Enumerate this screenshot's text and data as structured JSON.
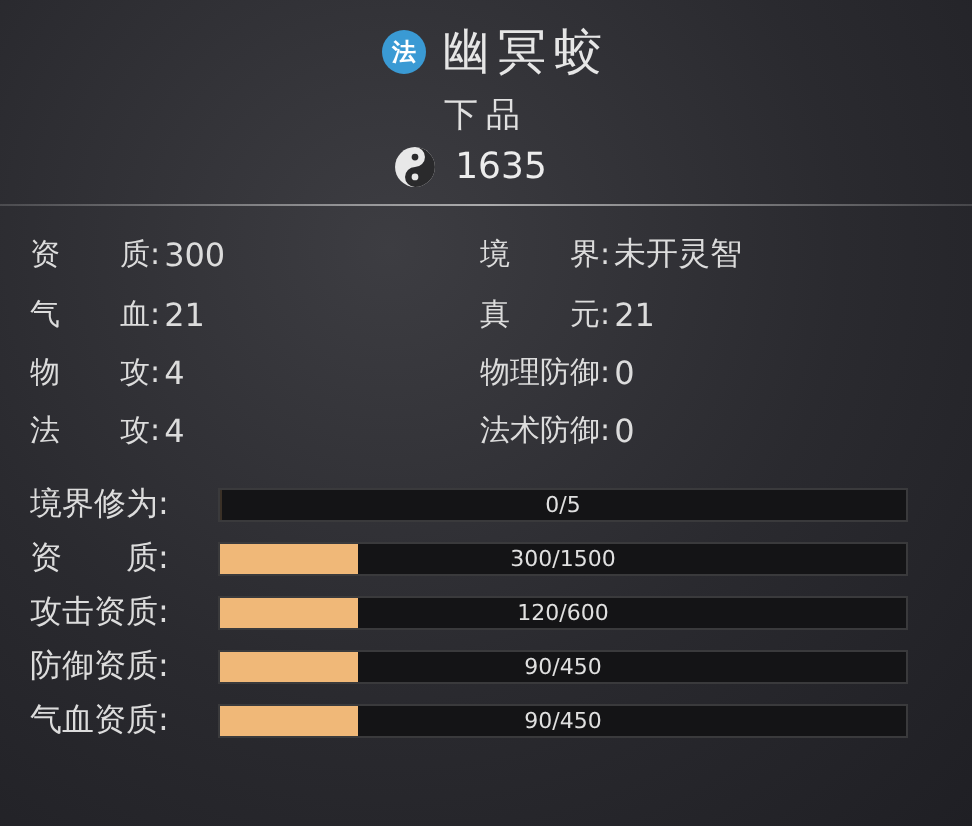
{
  "header": {
    "badge": "法",
    "name": "幽冥蛟",
    "grade": "下品",
    "points": "1635"
  },
  "stats": [
    {
      "label": "资　　质:",
      "value": "300"
    },
    {
      "label": "境　　界:",
      "value": "未开灵智"
    },
    {
      "label": "气　　血:",
      "value": "21"
    },
    {
      "label": "真　　元:",
      "value": "21"
    },
    {
      "label": "物　　攻:",
      "value": "4"
    },
    {
      "label": "物理防御:",
      "value": "0"
    },
    {
      "label": "法　　攻:",
      "value": "4"
    },
    {
      "label": "法术防御:",
      "value": "0"
    }
  ],
  "bars": [
    {
      "label": "境界修为:",
      "level": 0,
      "reading": "0/5"
    },
    {
      "label": "资　　质:",
      "level": 0.2,
      "reading": "300/1500"
    },
    {
      "label": "攻击资质:",
      "level": 0.2,
      "reading": "120/600"
    },
    {
      "label": "防御资质:",
      "level": 0.2,
      "reading": "90/450"
    },
    {
      "label": "气血资质:",
      "level": 0.2,
      "reading": "90/450"
    }
  ]
}
